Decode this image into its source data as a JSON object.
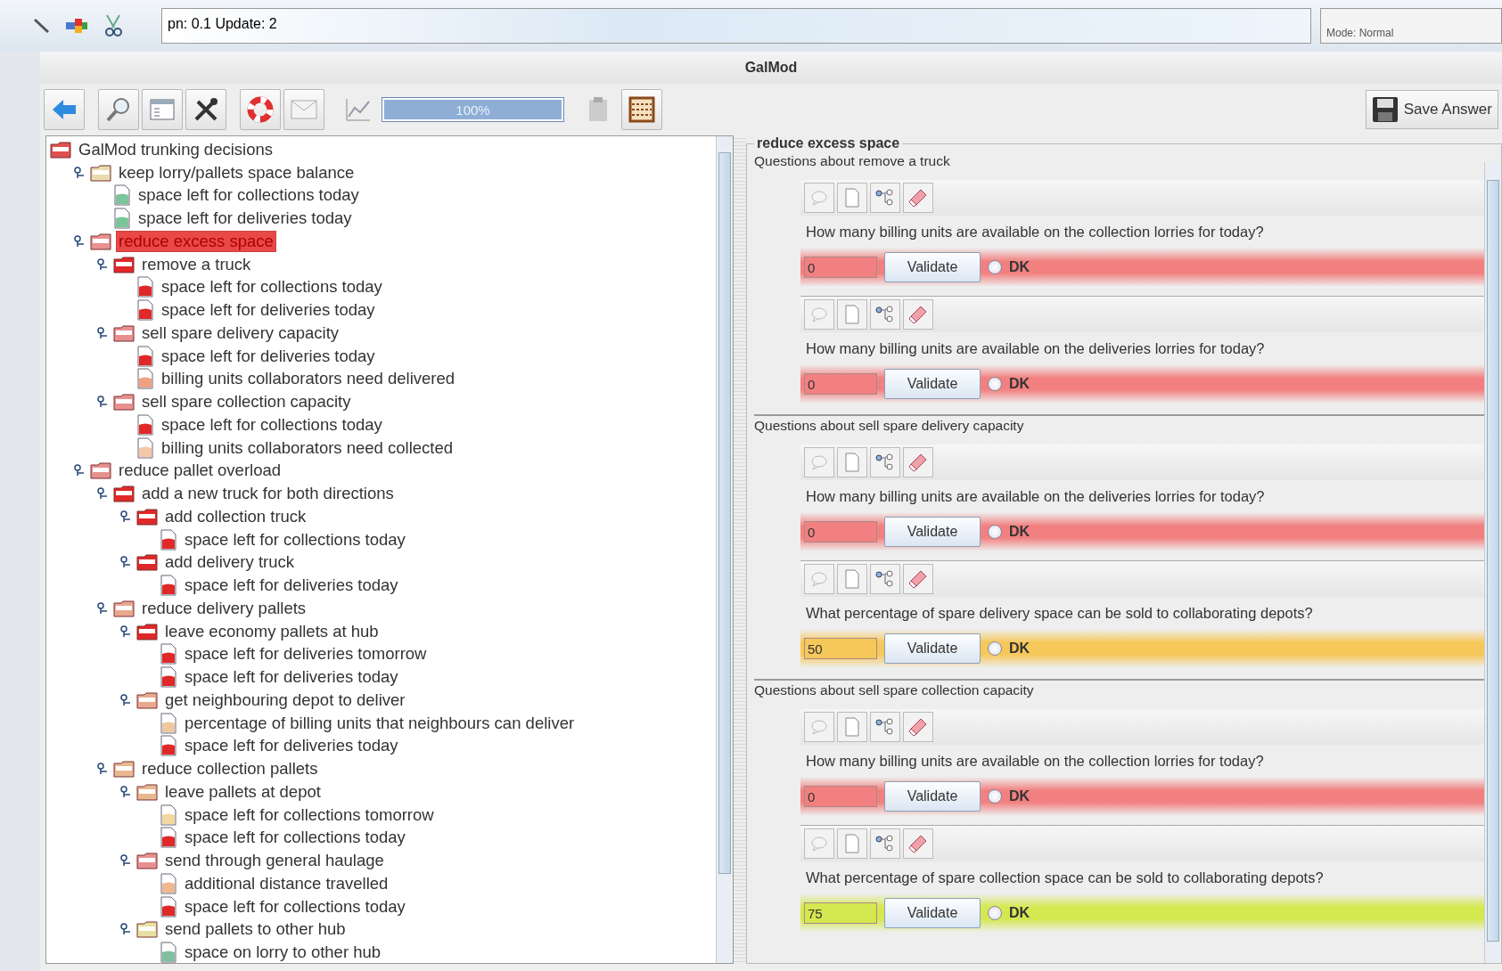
{
  "top_bar": {
    "version_text": "pn: 0.1 Update: 2",
    "mode_text": "Mode: Normal"
  },
  "window": {
    "title": "GalMod"
  },
  "toolbar": {
    "progress": {
      "level": 1,
      "label": "100%"
    },
    "save_button": "Save Answer"
  },
  "tree": [
    {
      "label": "GalMod trunking decisions",
      "kind": "folder",
      "color": "#e05050",
      "selected": false,
      "children": [
        {
          "label": "keep lorry/pallets space balance",
          "kind": "folder",
          "color": "#e8dcb0",
          "selected": false,
          "children": [
            {
              "label": "space left for collections today",
              "kind": "doc",
              "color": "#7cc49a",
              "selected": false
            },
            {
              "label": "space left for deliveries today",
              "kind": "doc",
              "color": "#7cc49a",
              "selected": false
            }
          ]
        },
        {
          "label": "reduce excess space",
          "kind": "folder",
          "color": "#e89090",
          "selected": true,
          "children": [
            {
              "label": "remove a truck",
              "kind": "folder",
              "color": "#e02828",
              "selected": false,
              "children": [
                {
                  "label": "space left for collections today",
                  "kind": "doc",
                  "color": "#e02828",
                  "selected": false
                },
                {
                  "label": "space left for deliveries today",
                  "kind": "doc",
                  "color": "#e02828",
                  "selected": false
                }
              ]
            },
            {
              "label": "sell spare delivery capacity",
              "kind": "folder",
              "color": "#e89090",
              "selected": false,
              "children": [
                {
                  "label": "space left for deliveries today",
                  "kind": "doc",
                  "color": "#e02828",
                  "selected": false
                },
                {
                  "label": "billing units collaborators need delivered",
                  "kind": "doc",
                  "color": "#f0a080",
                  "selected": false
                }
              ]
            },
            {
              "label": "sell spare collection capacity",
              "kind": "folder",
              "color": "#e89090",
              "selected": false,
              "children": [
                {
                  "label": "space left for collections today",
                  "kind": "doc",
                  "color": "#e02828",
                  "selected": false
                },
                {
                  "label": "billing units collaborators need collected",
                  "kind": "doc",
                  "color": "#f4c8a8",
                  "selected": false
                }
              ]
            }
          ]
        },
        {
          "label": "reduce pallet overload",
          "kind": "folder",
          "color": "#e89090",
          "selected": false,
          "children": [
            {
              "label": "add a new truck for both directions",
              "kind": "folder",
              "color": "#e02828",
              "selected": false,
              "children": [
                {
                  "label": "add collection truck",
                  "kind": "folder",
                  "color": "#e02828",
                  "selected": false,
                  "children": [
                    {
                      "label": "space left for collections today",
                      "kind": "doc",
                      "color": "#e02828",
                      "selected": false
                    }
                  ]
                },
                {
                  "label": "add delivery truck",
                  "kind": "folder",
                  "color": "#e02828",
                  "selected": false,
                  "children": [
                    {
                      "label": "space left for deliveries today",
                      "kind": "doc",
                      "color": "#e02828",
                      "selected": false
                    }
                  ]
                }
              ]
            },
            {
              "label": "reduce delivery pallets",
              "kind": "folder",
              "color": "#e8a890",
              "selected": false,
              "children": [
                {
                  "label": "leave economy pallets at hub",
                  "kind": "folder",
                  "color": "#e02828",
                  "selected": false,
                  "children": [
                    {
                      "label": "space left for deliveries tomorrow",
                      "kind": "doc",
                      "color": "#e02828",
                      "selected": false
                    },
                    {
                      "label": "space left for deliveries today",
                      "kind": "doc",
                      "color": "#e02828",
                      "selected": false
                    }
                  ]
                },
                {
                  "label": "get neighbouring depot to deliver",
                  "kind": "folder",
                  "color": "#e8a890",
                  "selected": false,
                  "children": [
                    {
                      "label": "percentage of billing units that neighbours can deliver",
                      "kind": "doc",
                      "color": "#f0c8a0",
                      "selected": false
                    },
                    {
                      "label": "space left for deliveries today",
                      "kind": "doc",
                      "color": "#e02828",
                      "selected": false
                    }
                  ]
                }
              ]
            },
            {
              "label": "reduce collection pallets",
              "kind": "folder",
              "color": "#e8b890",
              "selected": false,
              "children": [
                {
                  "label": "leave pallets at depot",
                  "kind": "folder",
                  "color": "#e8b890",
                  "selected": false,
                  "children": [
                    {
                      "label": "space left for collections tomorrow",
                      "kind": "doc",
                      "color": "#f4d8a0",
                      "selected": false
                    },
                    {
                      "label": "space left for collections today",
                      "kind": "doc",
                      "color": "#e02828",
                      "selected": false
                    }
                  ]
                },
                {
                  "label": "send through general haulage",
                  "kind": "folder",
                  "color": "#e89090",
                  "selected": false,
                  "children": [
                    {
                      "label": "additional distance travelled",
                      "kind": "doc",
                      "color": "#f0b890",
                      "selected": false
                    },
                    {
                      "label": "space left for collections today",
                      "kind": "doc",
                      "color": "#e02828",
                      "selected": false
                    }
                  ]
                },
                {
                  "label": "send pallets to other hub",
                  "kind": "folder",
                  "color": "#e8e0a0",
                  "selected": false,
                  "children": [
                    {
                      "label": "space on lorry to other hub",
                      "kind": "doc",
                      "color": "#80c0a0",
                      "selected": false
                    }
                  ]
                }
              ]
            }
          ]
        }
      ]
    }
  ],
  "detail": {
    "title": "reduce excess space",
    "sections": [
      {
        "heading": "Questions about remove a truck",
        "questions": [
          {
            "text": "How many billing units are available on the collection lorries for today?",
            "value": "0",
            "button": "Validate",
            "dk_label": "DK",
            "dk_checked": false,
            "color": "#f28080"
          },
          {
            "text": "How many billing units are available on the deliveries lorries for today?",
            "value": "0",
            "button": "Validate",
            "dk_label": "DK",
            "dk_checked": false,
            "color": "#f28080"
          }
        ]
      },
      {
        "heading": "Questions about sell spare delivery capacity",
        "questions": [
          {
            "text": "How many billing units are available on the deliveries lorries for today?",
            "value": "0",
            "button": "Validate",
            "dk_label": "DK",
            "dk_checked": false,
            "color": "#f28080"
          },
          {
            "text": "What percentage of spare delivery space can be sold to collaborating depots?",
            "value": "50",
            "button": "Validate",
            "dk_label": "DK",
            "dk_checked": false,
            "color": "#f6c85a"
          }
        ]
      },
      {
        "heading": "Questions about sell spare collection capacity",
        "questions": [
          {
            "text": "How many billing units are available on the collection lorries for today?",
            "value": "0",
            "button": "Validate",
            "dk_label": "DK",
            "dk_checked": false,
            "color": "#f28080"
          },
          {
            "text": "What percentage of spare collection space can be sold to collaborating depots?",
            "value": "75",
            "button": "Validate",
            "dk_label": "DK",
            "dk_checked": false,
            "color": "#d4e850"
          }
        ]
      }
    ]
  }
}
